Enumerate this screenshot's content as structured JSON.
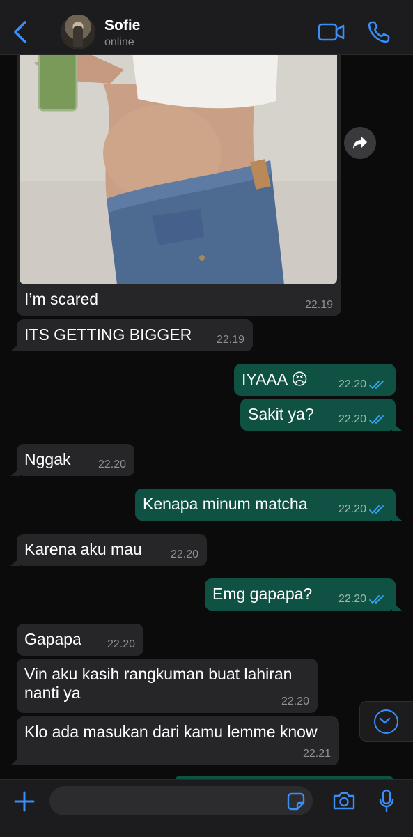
{
  "header": {
    "name": "Sofie",
    "status": "online"
  },
  "image_message": {
    "caption": "I’m scared",
    "time": "22.19"
  },
  "messages": [
    {
      "dir": "in",
      "text": "ITS GETTING BIGGER",
      "time": "22.19"
    },
    {
      "dir": "out",
      "text": "IYAAA 😣",
      "time": "22.20"
    },
    {
      "dir": "out",
      "text": "Sakit ya?",
      "time": "22.20"
    },
    {
      "dir": "in",
      "text": "Nggak",
      "time": "22.20"
    },
    {
      "dir": "out",
      "text": "Kenapa minum matcha",
      "time": "22.20"
    },
    {
      "dir": "in",
      "text": "Karena aku mau",
      "time": "22.20"
    },
    {
      "dir": "out",
      "text": "Emg gapapa?",
      "time": "22.20"
    },
    {
      "dir": "in",
      "text": "Gapapa",
      "time": "22.20"
    },
    {
      "dir": "in",
      "text_line1": "Vin aku kasih rangkuman buat lahiran",
      "text_line2": "nanti ya",
      "time": "22.20"
    },
    {
      "dir": "in",
      "text": "Klo ada masukan dari kamu lemme know",
      "time": "22.21"
    }
  ],
  "input": {
    "placeholder": ""
  },
  "colors": {
    "accent": "#3a8ef6",
    "incoming_bubble": "#262628",
    "outgoing_bubble": "#0f5244",
    "background": "#0b0b0c"
  },
  "icons": [
    "back-chevron-icon",
    "video-call-icon",
    "phone-icon",
    "forward-icon",
    "scroll-down-icon",
    "plus-icon",
    "sticker-icon",
    "camera-icon",
    "microphone-icon",
    "double-check-icon"
  ]
}
